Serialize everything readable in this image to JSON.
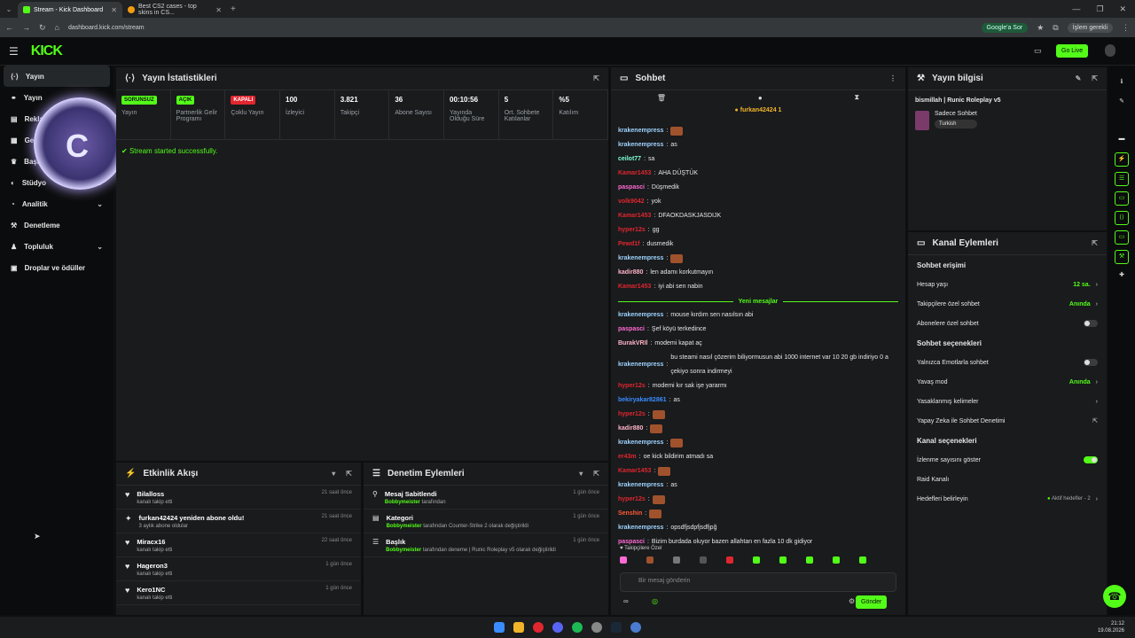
{
  "tabs": [
    {
      "label": "Stream - Kick Dashboard"
    },
    {
      "label": "Best CS2 cases - top skins in CS..."
    }
  ],
  "address": {
    "url": "dashboard.kick.com/stream",
    "google": "Google'a Sor",
    "profile": "İşlem gerekli"
  },
  "header": {
    "logo": "KICK",
    "golive": "Go Live"
  },
  "sidebar": {
    "items": [
      {
        "label": "Yayın"
      },
      {
        "label": "Yayın"
      },
      {
        "label": "Reklam"
      },
      {
        "label": "Gelir"
      },
      {
        "label": "Başarılar"
      },
      {
        "label": "Stüdyo"
      },
      {
        "label": "Analitik"
      },
      {
        "label": "Denetleme"
      },
      {
        "label": "Topluluk"
      },
      {
        "label": "Droplar ve ödüller"
      }
    ]
  },
  "stats": {
    "title": "Yayın İstatistikleri",
    "items": [
      {
        "badge": "SORUNSUZ",
        "badge_color": "#53fc18",
        "label": "Yayın"
      },
      {
        "badge": "AÇIK",
        "badge_color": "#53fc18",
        "label": "Partnerlik Gelir Programı"
      },
      {
        "badge": "KAPALI",
        "badge_color": "#e0262f",
        "label": "Çoklu Yayın"
      },
      {
        "value": "100",
        "label": "İzleyici"
      },
      {
        "value": "3.821",
        "label": "Takipçi"
      },
      {
        "value": "36",
        "label": "Abone Sayısı"
      },
      {
        "value": "00:10:56",
        "label": "Yayında Olduğu Süre"
      },
      {
        "value": "5",
        "label": "Ort. Sohbete Katılanlar"
      },
      {
        "value": "%5",
        "label": "Katılım"
      }
    ],
    "status": "Stream started successfully."
  },
  "activity": {
    "title": "Etkinlik Akışı",
    "rows": [
      {
        "title": "Bilalloss",
        "sub": "kanalı takip etti",
        "time": "21 saat önce"
      },
      {
        "title": "furkan42424 yeniden abone oldu!",
        "sub": "3 aylık abone oldular",
        "time": "21 saat önce"
      },
      {
        "title": "Miracx16",
        "sub": "kanalı takip etti",
        "time": "22 saat önce"
      },
      {
        "title": "Hageron3",
        "sub": "kanalı takip etti",
        "time": "1 gün önce"
      },
      {
        "title": "Kero1NC",
        "sub": "kanalı takip etti",
        "time": "1 gün önce"
      }
    ]
  },
  "mod": {
    "title": "Denetim Eylemleri",
    "rows": [
      {
        "title": "Mesaj Sabitlendi",
        "by": "Bobbymeister",
        "rest": "tarafından",
        "time": "1 gün önce"
      },
      {
        "title": "Kategori",
        "by": "Bobbymeister",
        "rest": "tarafından Counter-Strike 2 olarak değiştirildi",
        "time": "1 gün önce"
      },
      {
        "title": "Başlık",
        "by": "Bobbymeister",
        "rest": "tarafından deneme | Runic Roleplay v5 olarak değiştirildi",
        "time": "1 gün önce"
      }
    ]
  },
  "chat": {
    "title": "Sohbet",
    "pinned": "furkan42424",
    "newmsg": "Yeni mesajlar",
    "placeholder": "Bir mesaj gönderin",
    "send": "Gönder",
    "followers_only": "Takipçilere Özel",
    "lines": [
      {
        "user": "krakenempress",
        "color": "#9fd3ff",
        "text": ""
      },
      {
        "user": "krakenempress",
        "color": "#9fd3ff",
        "text": "as"
      },
      {
        "user": "ceilot77",
        "color": "#7fffd4",
        "text": "sa"
      },
      {
        "user": "Kamar1453",
        "color": "#e0262f",
        "text": "AHA DÜŞTÜK"
      },
      {
        "user": "paspasci",
        "color": "#ff6ad5",
        "text": "Düşmedik"
      },
      {
        "user": "volk9042",
        "color": "#e0262f",
        "text": "yok"
      },
      {
        "user": "Kamar1453",
        "color": "#e0262f",
        "text": "DFAOKDASKJASDIJK"
      },
      {
        "user": "hyper12s",
        "color": "#e0262f",
        "text": "gg"
      },
      {
        "user": "Pewd1f",
        "color": "#e0262f",
        "text": "dusmedik"
      },
      {
        "user": "krakenempress",
        "color": "#9fd3ff",
        "text": ""
      },
      {
        "user": "kadir880",
        "color": "#ffb3c6",
        "text": "len adamı korkutmayın"
      },
      {
        "user": "Kamar1453",
        "color": "#e0262f",
        "text": "iyi abi sen nabin"
      }
    ],
    "lines2": [
      {
        "user": "krakenempress",
        "color": "#9fd3ff",
        "text": "mouse kırdım sen nasılsın abi"
      },
      {
        "user": "paspasci",
        "color": "#ff6ad5",
        "text": "Şef köyü terkedince"
      },
      {
        "user": "BurakVRIl",
        "color": "#ffb3c6",
        "text": "modemi kapat aç"
      },
      {
        "user": "krakenempress",
        "color": "#9fd3ff",
        "text": "bu steami nasıl çözerim biliyormusun abi 1000 internet var 10 20 gb indiriyo 0 a çekiyo sonra indirmeyi"
      },
      {
        "user": "hyper12s",
        "color": "#e0262f",
        "text": "modemi kır sak işe yararmı"
      },
      {
        "user": "bekiryakar82861",
        "color": "#3a8bff",
        "text": "as"
      },
      {
        "user": "hyper12s",
        "color": "#e0262f",
        "text": ""
      },
      {
        "user": "kadir880",
        "color": "#ffb3c6",
        "text": ""
      },
      {
        "user": "krakenempress",
        "color": "#9fd3ff",
        "text": ""
      },
      {
        "user": "er43m",
        "color": "#e0262f",
        "text": "oe kick bildirim atmadı sa"
      },
      {
        "user": "Kamar1453",
        "color": "#e0262f",
        "text": ""
      },
      {
        "user": "krakenempress",
        "color": "#9fd3ff",
        "text": "as"
      },
      {
        "user": "hyper12s",
        "color": "#e0262f",
        "text": ""
      },
      {
        "user": "Senshin",
        "color": "#ff5a36",
        "text": ""
      },
      {
        "user": "krakenempress",
        "color": "#9fd3ff",
        "text": "opsdfjsdpfjsdfjpğ"
      },
      {
        "user": "paspasci",
        "color": "#ff6ad5",
        "text": "Bizim burdada oluyor bazen allahtan en fazla 10 dk gidiyor"
      }
    ]
  },
  "info": {
    "title": "Yayın bilgisi",
    "stream_title": "bismillah | Runic Roleplay v5",
    "category": "Sadece Sohbet",
    "tag": "Turkish"
  },
  "channel": {
    "title": "Kanal Eylemleri",
    "access": "Sohbet erişimi",
    "account_age": "Hesap yaşı",
    "account_age_val": "12 sa.",
    "followers": "Takipçilere özel sohbet",
    "followers_val": "Anında",
    "subs": "Abonelere özel sohbet",
    "options": "Sohbet seçenekleri",
    "emote": "Yalnızca Emotlarla sohbet",
    "slow": "Yavaş mod",
    "slow_val": "Anında",
    "banned": "Yasaklanmış kelimeler",
    "ai": "Yapay Zeka ile Sohbet Denetimi",
    "chanopt": "Kanal seçenekleri",
    "viewers": "İzlenme sayısını göster",
    "raid": "Raid Kanalı",
    "goals": "Hedefleri belirleyin",
    "goals_val": "Aktif hedefler - 2"
  },
  "clock": {
    "time": "21:12",
    "date": "19.08.2026"
  }
}
